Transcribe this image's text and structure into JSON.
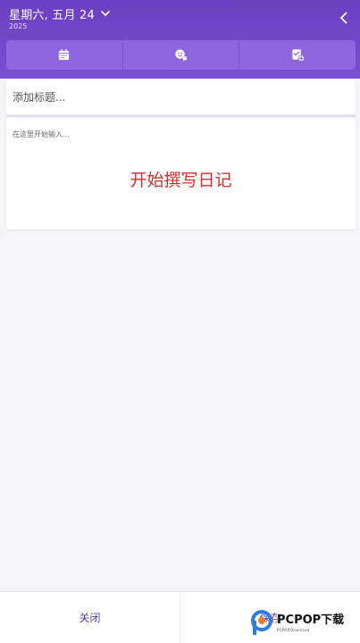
{
  "header": {
    "date": "星期六, 五月 24",
    "year": "2025",
    "date_dropdown_icon": "chevron-down-icon",
    "back_icon": "chevron-left-icon",
    "background_color": "#6b3fc0"
  },
  "toolbar": {
    "background_color": "#8f66de",
    "buttons": [
      {
        "icon": "calendar-icon"
      },
      {
        "icon": "mood-chat-icon"
      },
      {
        "icon": "task-add-icon"
      }
    ]
  },
  "editor": {
    "title_placeholder": "添加标题...",
    "title_value": "",
    "body_placeholder": "在这里开始输入...",
    "body_value": "",
    "overlay_caption": "开始撰写日记",
    "overlay_caption_color": "#d12e2e"
  },
  "footer": {
    "close_label": "关闭",
    "save_label": "保存",
    "label_color": "#5a3ca8"
  },
  "watermark": {
    "brand": "PCPOP下载",
    "sub": "PCPOP.Download"
  }
}
